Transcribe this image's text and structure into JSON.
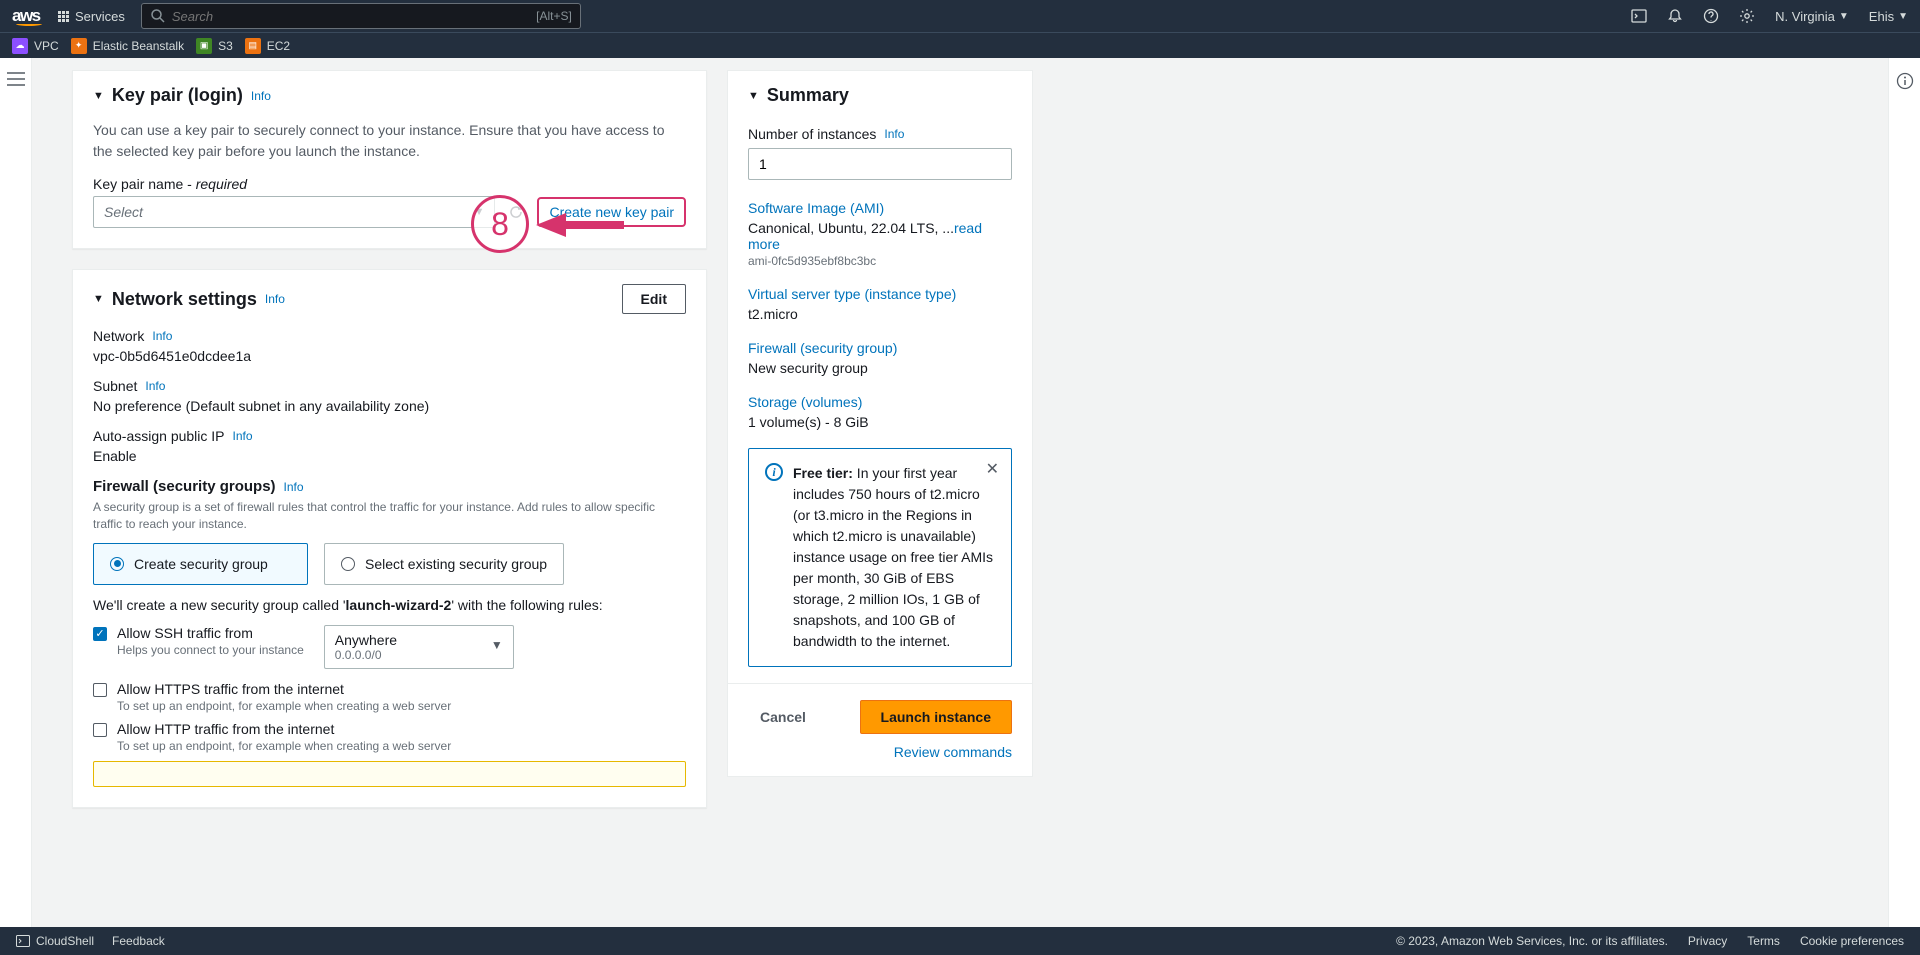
{
  "topnav": {
    "services": "Services",
    "search_placeholder": "Search",
    "shortcut": "[Alt+S]",
    "region": "N. Virginia",
    "user": "Ehis"
  },
  "favorites": {
    "vpc": "VPC",
    "eb": "Elastic Beanstalk",
    "s3": "S3",
    "ec2": "EC2"
  },
  "keypair": {
    "title": "Key pair (login)",
    "info": "Info",
    "desc": "You can use a key pair to securely connect to your instance. Ensure that you have access to the selected key pair before you launch the instance.",
    "label_pre": "Key pair name - ",
    "label_req": "required",
    "placeholder": "Select",
    "create_link": "Create new key pair"
  },
  "annotation": {
    "number": "8"
  },
  "network": {
    "title": "Network settings",
    "info": "Info",
    "edit": "Edit",
    "net_label": "Network",
    "net_val": "vpc-0b5d6451e0dcdee1a",
    "subnet_label": "Subnet",
    "subnet_val": "No preference (Default subnet in any availability zone)",
    "ip_label": "Auto-assign public IP",
    "ip_val": "Enable",
    "fw_title": "Firewall (security groups)",
    "fw_desc": "A security group is a set of firewall rules that control the traffic for your instance. Add rules to allow specific traffic to reach your instance.",
    "sg_create": "Create security group",
    "sg_select": "Select existing security group",
    "rule_text_pre": "We'll create a new security group called '",
    "rule_name": "launch-wizard-2",
    "rule_text_post": "' with the following rules:",
    "ssh_label": "Allow SSH traffic from",
    "ssh_hint": "Helps you connect to your instance",
    "ssh_sel_line1": "Anywhere",
    "ssh_sel_line2": "0.0.0.0/0",
    "https_label": "Allow HTTPS traffic from the internet",
    "https_hint": "To set up an endpoint, for example when creating a web server",
    "http_label": "Allow HTTP traffic from the internet",
    "http_hint": "To set up an endpoint, for example when creating a web server"
  },
  "summary": {
    "title": "Summary",
    "num_label": "Number of instances",
    "info": "Info",
    "num_val": "1",
    "ami_label": "Software Image (AMI)",
    "ami_val": "Canonical, Ubuntu, 22.04 LTS, ...",
    "read_more": "read more",
    "ami_id": "ami-0fc5d935ebf8bc3bc",
    "inst_label": "Virtual server type (instance type)",
    "inst_val": "t2.micro",
    "fw_label": "Firewall (security group)",
    "fw_val": "New security group",
    "stor_label": "Storage (volumes)",
    "stor_val": "1 volume(s) - 8 GiB",
    "free_tier_bold": "Free tier:",
    "free_tier_text": " In your first year includes 750 hours of t2.micro (or t3.micro in the Regions in which t2.micro is unavailable) instance usage on free tier AMIs per month, 30 GiB of EBS storage, 2 million IOs, 1 GB of snapshots, and 100 GB of bandwidth to the internet.",
    "cancel": "Cancel",
    "launch": "Launch instance",
    "review": "Review commands"
  },
  "footer": {
    "cloudshell": "CloudShell",
    "feedback": "Feedback",
    "copyright": "© 2023, Amazon Web Services, Inc. or its affiliates.",
    "privacy": "Privacy",
    "terms": "Terms",
    "cookies": "Cookie preferences"
  }
}
